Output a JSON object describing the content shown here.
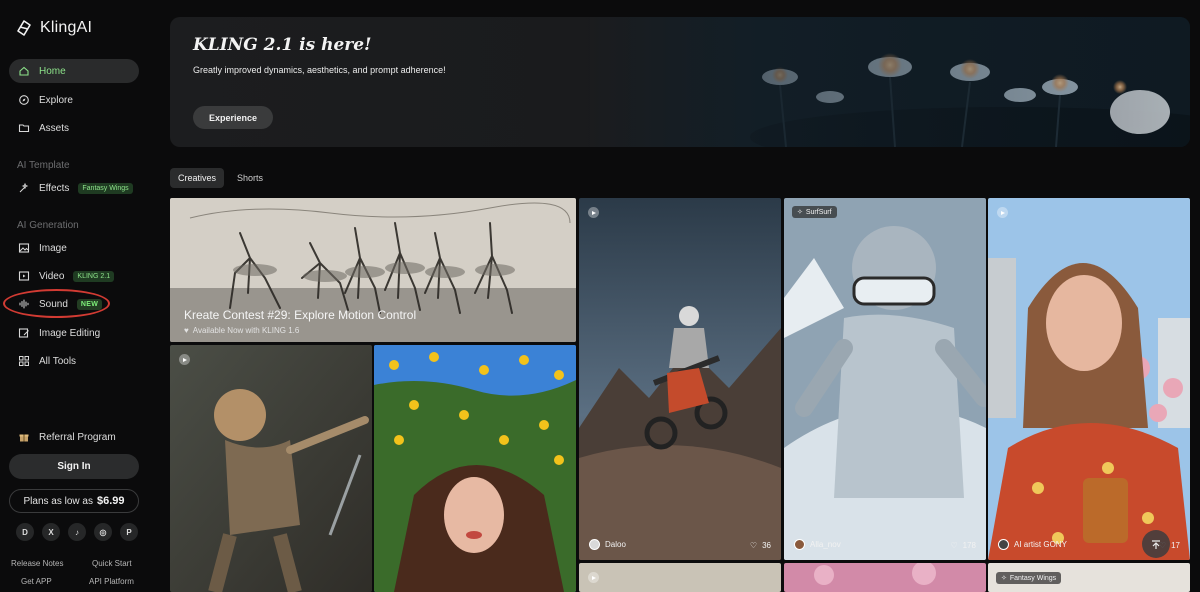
{
  "brand": {
    "name": "KlingAI"
  },
  "sidebar": {
    "nav": [
      {
        "label": "Home",
        "icon": "home-icon"
      },
      {
        "label": "Explore",
        "icon": "compass-icon"
      },
      {
        "label": "Assets",
        "icon": "folder-icon"
      }
    ],
    "ai_template": {
      "label": "AI Template",
      "items": [
        {
          "label": "Effects",
          "badge": "Fantasy Wings",
          "icon": "effects-icon"
        }
      ]
    },
    "ai_generation": {
      "label": "AI Generation",
      "items": [
        {
          "label": "Image",
          "icon": "image-icon"
        },
        {
          "label": "Video",
          "badge": "KLING 2.1",
          "icon": "video-icon"
        },
        {
          "label": "Sound",
          "badge": "NEW",
          "icon": "sound-wave-icon"
        },
        {
          "label": "Image Editing",
          "icon": "image-edit-icon"
        },
        {
          "label": "All Tools",
          "icon": "grid-icon"
        }
      ]
    },
    "referral": "Referral Program",
    "sign_in": "Sign In",
    "plans": {
      "prefix": "Plans as low as",
      "price": "$6.99"
    },
    "socials": [
      {
        "name": "discord-icon",
        "glyph": "D"
      },
      {
        "name": "x-icon",
        "glyph": "X"
      },
      {
        "name": "tiktok-icon",
        "glyph": "♪"
      },
      {
        "name": "instagram-icon",
        "glyph": "◎"
      },
      {
        "name": "pinterest-icon",
        "glyph": "P"
      }
    ],
    "footer_links": [
      "Release Notes",
      "Quick Start",
      "Get APP",
      "API Platform"
    ]
  },
  "banner": {
    "title": "KLING 2.1 is here!",
    "subtitle": "Greatly improved dynamics, aesthetics, and prompt adherence!",
    "cta": "Experience"
  },
  "tabs": [
    {
      "label": "Creatives",
      "active": true
    },
    {
      "label": "Shorts",
      "active": false
    }
  ],
  "cards": {
    "contest": {
      "title": "Kreate Contest #29: Explore Motion Control",
      "subtitle": "Available Now with KLING 1.6"
    },
    "moto": {
      "creator": "Daloo",
      "likes": "36"
    },
    "snow": {
      "tag": "SurfSurf",
      "creator": "Alla_nov",
      "likes": "178"
    },
    "portrait": {
      "creator": "AI artist GONY",
      "likes": "17"
    },
    "wings": {
      "tag": "Fantasy Wings"
    }
  },
  "colors": {
    "accent": "#8de38a",
    "highlight_ring": "#d23b33",
    "background": "#0b0b0c"
  }
}
